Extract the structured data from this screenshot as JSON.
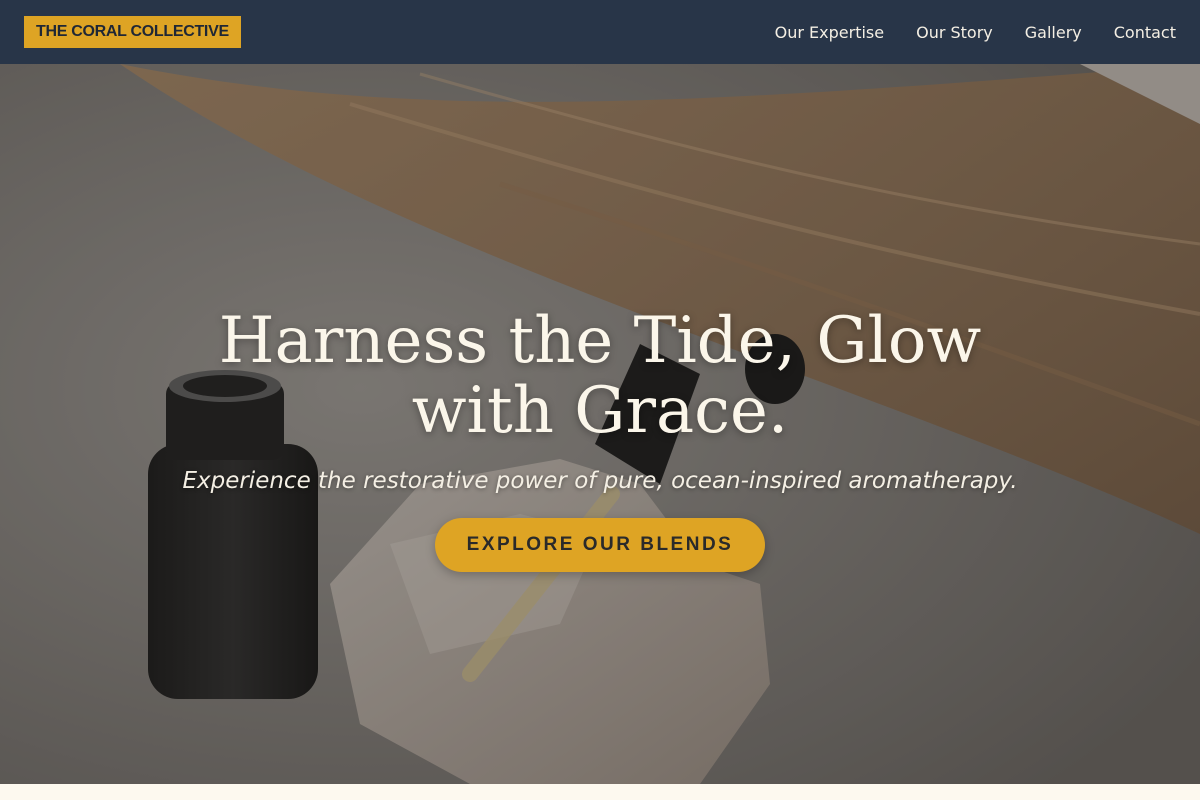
{
  "brand": {
    "name": "THE CORAL COLLECTIVE"
  },
  "nav": {
    "links": [
      {
        "label": "Our Expertise"
      },
      {
        "label": "Our Story"
      },
      {
        "label": "Gallery"
      },
      {
        "label": "Contact"
      }
    ]
  },
  "hero": {
    "title_line1": "Harness the Tide, Glow",
    "title_line2": "with Grace.",
    "subtitle": "Experience the restorative power of pure, ocean-inspired aromatherapy.",
    "cta_label": "EXPLORE OUR BLENDS"
  },
  "colors": {
    "navbar_bg": "#283548",
    "accent": "#dea424",
    "hero_text": "#fbf6ea",
    "page_bg": "#fdf9ef"
  },
  "icons": {
    "hero_image": "essential-oil-bottle-dropper-pampas-photo"
  }
}
